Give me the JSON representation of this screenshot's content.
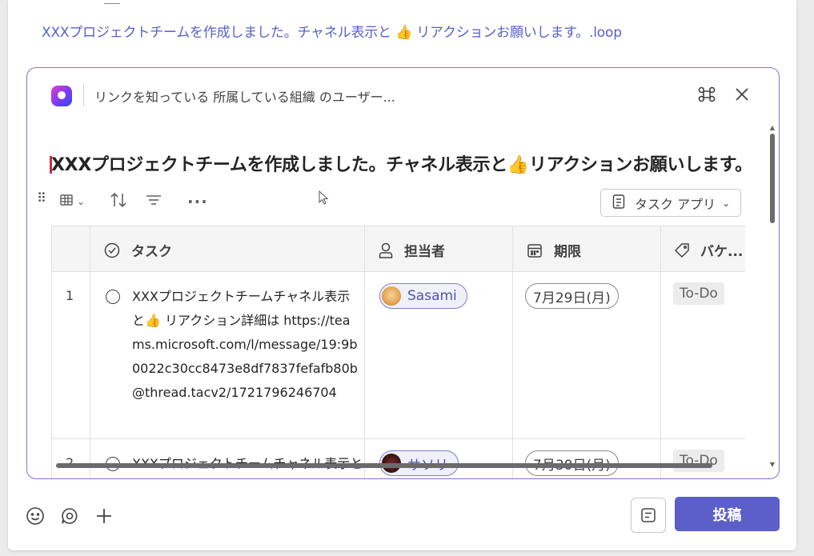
{
  "message": {
    "loop_link": "XXXプロジェクトチームを作成しました。チャネル表示と 👍 リアクションお願いします。.loop"
  },
  "loop_card": {
    "share_text": "リンクを知っている 所属している組織 のユーザー...",
    "title": "XXXプロジェクトチームを作成しました。チャネル表示と👍リアクションお願いします。",
    "toolbar": {
      "more_label": "···",
      "app_button_label": "タスク アプリ"
    },
    "table": {
      "columns": [
        {
          "label": "タスク",
          "icon": "check-circle-icon"
        },
        {
          "label": "担当者",
          "icon": "person-icon"
        },
        {
          "label": "期限",
          "icon": "calendar-icon"
        },
        {
          "label": "バケ...",
          "icon": "tag-icon"
        }
      ],
      "rows": [
        {
          "num": "1",
          "task": "XXXプロジェクトチームチャネル表示と👍 リアクション詳細は https://teams.microsoft.com/l/message/19:9b0022c30cc8473e8df7837fefafb80b@thread.tacv2/1721796246704",
          "assignee": "Sasami",
          "due": "7月29日(月)",
          "bucket": "To-Do"
        },
        {
          "num": "2",
          "task": "XXXプロジェクトチームチャネル表示と",
          "assignee": "サソリ",
          "due": "7月30日(月)",
          "bucket": "To-Do"
        }
      ]
    }
  },
  "compose": {
    "post_label": "投稿"
  },
  "colors": {
    "accent": "#5b5fc7",
    "card_border": "#8a6fd6",
    "caret": "#c4314b"
  }
}
